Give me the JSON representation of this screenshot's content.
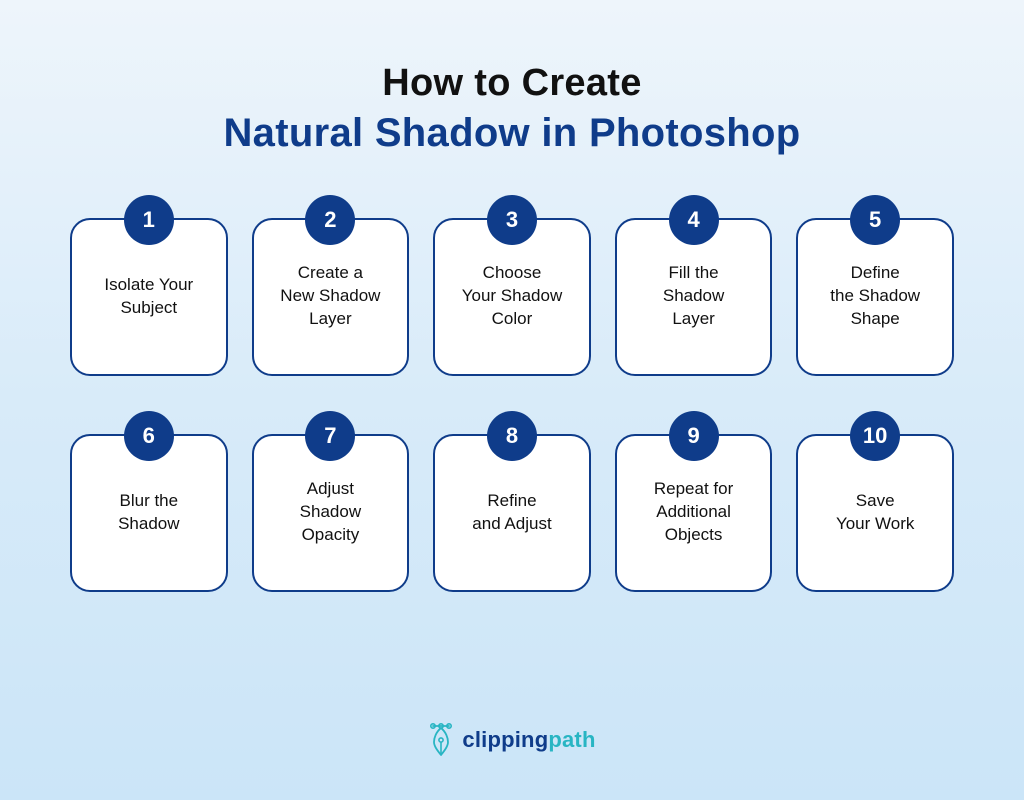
{
  "header": {
    "line1": "How to Create",
    "line2": "Natural Shadow in Photoshop"
  },
  "steps": [
    {
      "num": "1",
      "label": "Isolate Your\nSubject"
    },
    {
      "num": "2",
      "label": "Create a\nNew Shadow\nLayer"
    },
    {
      "num": "3",
      "label": "Choose\nYour Shadow\nColor"
    },
    {
      "num": "4",
      "label": "Fill the\nShadow\nLayer"
    },
    {
      "num": "5",
      "label": "Define\nthe Shadow\nShape"
    },
    {
      "num": "6",
      "label": "Blur the\nShadow"
    },
    {
      "num": "7",
      "label": "Adjust\nShadow\nOpacity"
    },
    {
      "num": "8",
      "label": "Refine\nand Adjust"
    },
    {
      "num": "9",
      "label": "Repeat for\nAdditional\nObjects"
    },
    {
      "num": "10",
      "label": "Save\nYour Work"
    }
  ],
  "brand": {
    "part1": "clipping",
    "part2": "path"
  },
  "colors": {
    "accent": "#0f3c8a",
    "teal": "#28b5c3",
    "card_bg": "#ffffff"
  }
}
